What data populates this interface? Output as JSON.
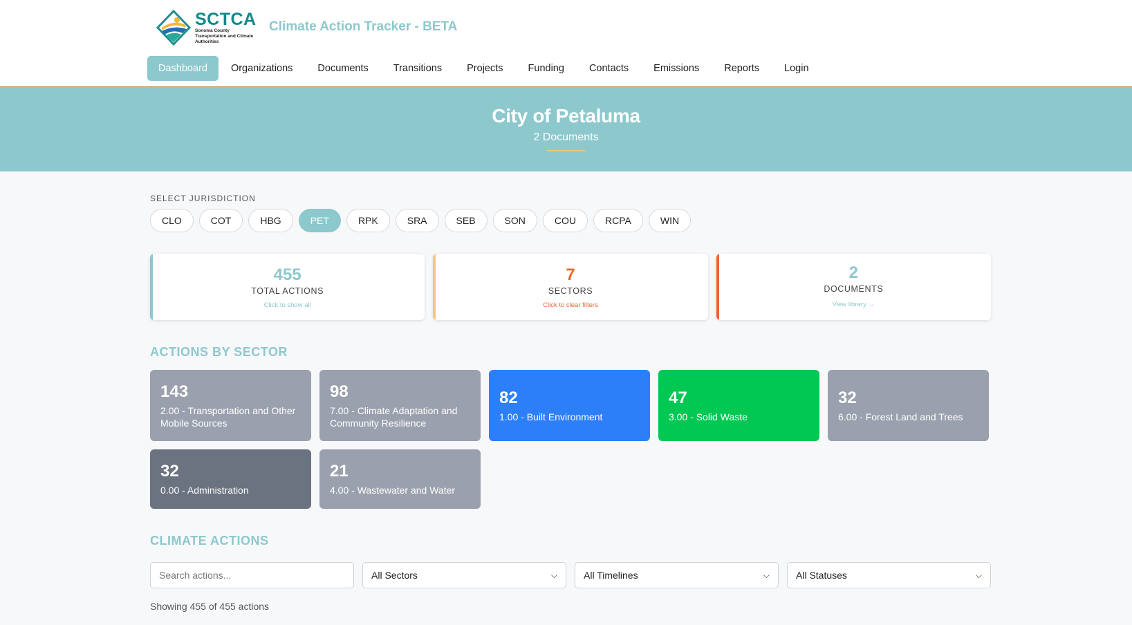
{
  "header": {
    "logo_title": "SCTCA",
    "logo_subtitle": "Sonoma County Transportation and Climate Authorities",
    "app_title": "Climate Action Tracker - BETA"
  },
  "nav": {
    "items": [
      "Dashboard",
      "Organizations",
      "Documents",
      "Transitions",
      "Projects",
      "Funding",
      "Contacts",
      "Emissions",
      "Reports",
      "Login"
    ],
    "active": "Dashboard"
  },
  "hero": {
    "title": "City of Petaluma",
    "subtitle": "2 Documents"
  },
  "jurisdiction": {
    "label": "SELECT JURISDICTION",
    "options": [
      "CLO",
      "COT",
      "HBG",
      "PET",
      "RPK",
      "SRA",
      "SEB",
      "SON",
      "COU",
      "RCPA",
      "WIN"
    ],
    "selected": "PET"
  },
  "stats": [
    {
      "value": "455",
      "label": "TOTAL ACTIONS",
      "hint": "Click to show all"
    },
    {
      "value": "7",
      "label": "SECTORS",
      "hint": "Click to clear filters"
    },
    {
      "value": "2",
      "label": "DOCUMENTS",
      "hint": "View library →"
    }
  ],
  "sectors": {
    "title": "ACTIONS BY SECTOR",
    "items": [
      {
        "count": "143",
        "name": "2.00 - Transportation and Other Mobile Sources",
        "color": "#9aa0ad"
      },
      {
        "count": "98",
        "name": "7.00 - Climate Adaptation and Community Resilience",
        "color": "#9aa0ad"
      },
      {
        "count": "82",
        "name": "1.00 - Built Environment",
        "color": "#2d7ff9"
      },
      {
        "count": "47",
        "name": "3.00 - Solid Waste",
        "color": "#00c853"
      },
      {
        "count": "32",
        "name": "6.00 - Forest Land and Trees",
        "color": "#9aa0ad"
      },
      {
        "count": "32",
        "name": "0.00 - Administration",
        "color": "#6b7280"
      },
      {
        "count": "21",
        "name": "4.00 - Wastewater and Water",
        "color": "#9aa0ad"
      }
    ]
  },
  "actions": {
    "title": "CLIMATE ACTIONS",
    "search_placeholder": "Search actions...",
    "sector_filter": "All Sectors",
    "timeline_filter": "All Timelines",
    "status_filter": "All Statuses",
    "showing": "Showing 455 of 455 actions"
  },
  "colors": {
    "accent": "#8dc8cd",
    "orange": "#e8662f",
    "gold": "#f0c88a"
  }
}
